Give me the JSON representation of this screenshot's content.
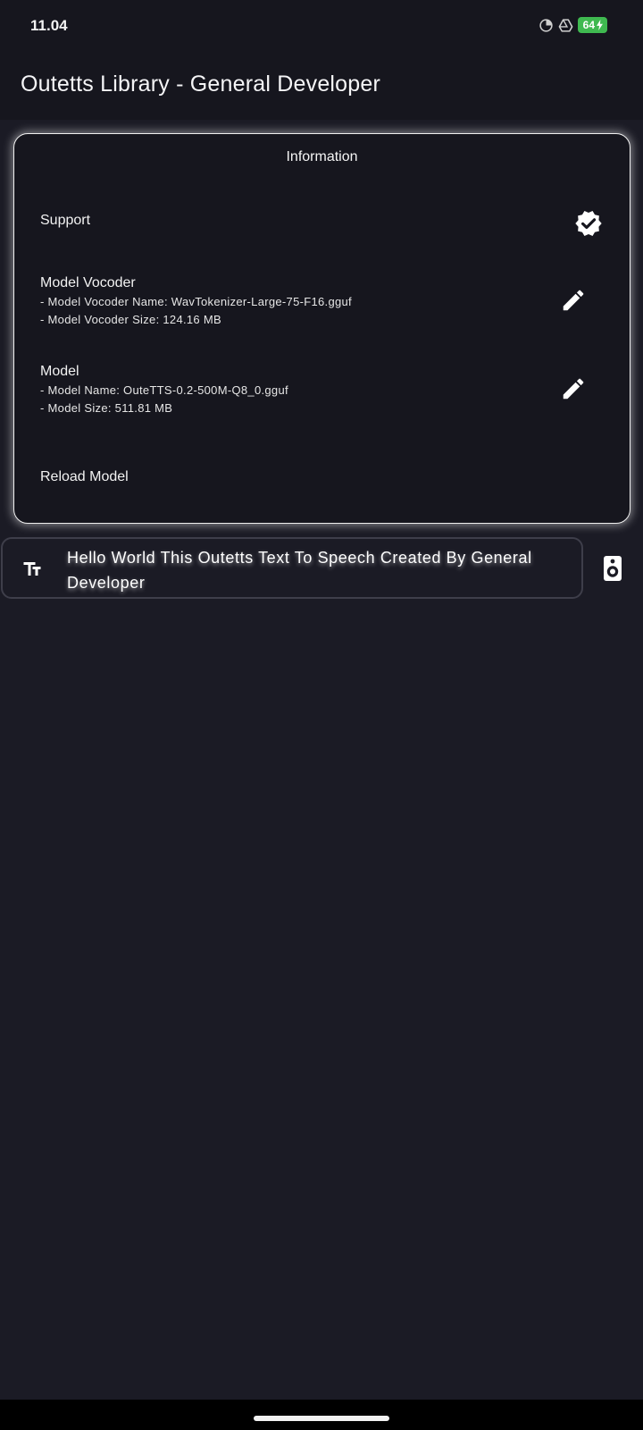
{
  "status_bar": {
    "time": "11.04",
    "battery_level": "64",
    "battery_color": "#3fb950",
    "icons": [
      "timer-icon",
      "drive-icon",
      "battery-icon",
      "charging-icon"
    ]
  },
  "app_bar": {
    "title": "Outetts Library - General Developer"
  },
  "info_card": {
    "title": "Information",
    "support": {
      "label": "Support",
      "icon": "verified-badge-icon"
    },
    "model_vocoder": {
      "label": "Model Vocoder",
      "name_line": "- Model Vocoder Name: WavTokenizer-Large-75-F16.gguf",
      "size_line": "- Model Vocoder Size: 124.16 MB",
      "icon": "edit-icon"
    },
    "model": {
      "label": "Model",
      "name_line": "- Model Name: OuteTTS-0.2-500M-Q8_0.gguf",
      "size_line": "- Model Size: 511.81 MB",
      "icon": "edit-icon"
    },
    "reload": {
      "label": "Reload Model"
    }
  },
  "tts_input": {
    "value": "Hello World This Outetts Text To Speech Created By General Developer",
    "leading_icon": "text-fields-icon",
    "action_icon": "speaker-icon"
  },
  "colors": {
    "background": "#1b1b25",
    "surface": "#16161e",
    "card_border": "#f0f0f0",
    "input_border": "#3e3e4a"
  }
}
